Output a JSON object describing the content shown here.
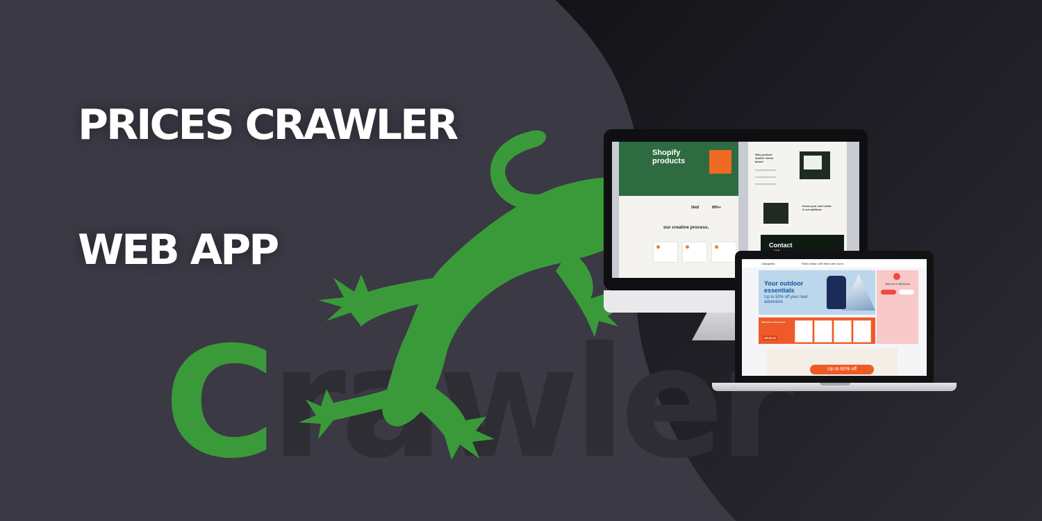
{
  "headline": {
    "line1": "PRICES CRAWLER",
    "line2": "WEB APP"
  },
  "logo": {
    "wordmark_first": "C",
    "wordmark_rest": "rawler",
    "color_green": "#3a9a3a",
    "color_dark": "#2e2d33"
  },
  "colors": {
    "background": "#3a3944",
    "background_dark": "#131216",
    "accent_orange": "#ee5a26"
  },
  "monitor_page_a": {
    "title": "Shopify products",
    "process": "our creative process.",
    "stat1": "5kk$",
    "stat2": "89%+"
  },
  "monitor_page_b": {
    "question": "Why product studio? lorem ipsum",
    "know": "Know your role inside & our platform.",
    "contact": "Contact with us"
  },
  "laptop_page": {
    "nav_categories": "Categories",
    "nav_links": "Flash Deals    LIVE    New User Zone",
    "banner_title": "Your outdoor essentials",
    "banner_sub": "Up to 50% off your next adventure",
    "welcome": "Welcome to AliExpress",
    "welcome_new": "Welcome newcomers!",
    "price": "US $2.00",
    "promo": "Up to 60% off"
  }
}
